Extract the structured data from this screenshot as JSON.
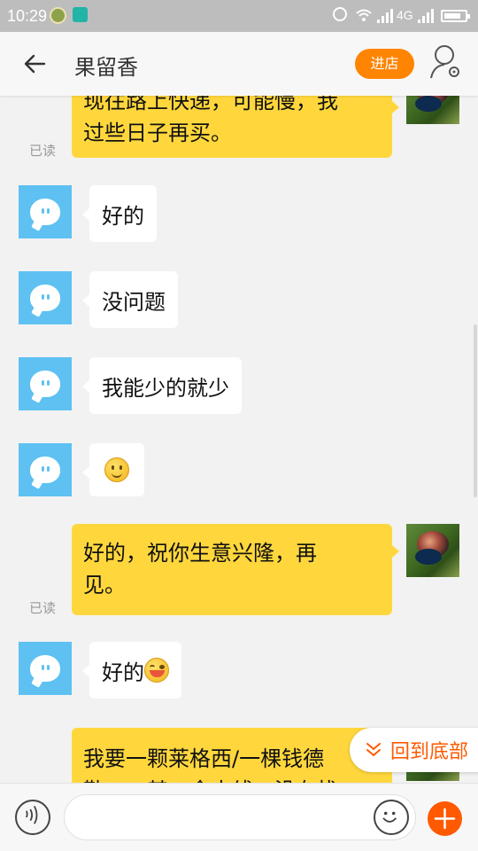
{
  "status_bar": {
    "time": "10:29",
    "network": "4G"
  },
  "header": {
    "title": "果留香",
    "shop_button": "进店"
  },
  "messages": [
    {
      "from": "me",
      "lines": [
        "现往路上快递，可能慢，我",
        "过些日子再买。"
      ],
      "read": "已读"
    },
    {
      "from": "other",
      "text": "好的"
    },
    {
      "from": "other",
      "text": "没问题"
    },
    {
      "from": "other",
      "text": "我能少的就少"
    },
    {
      "from": "other",
      "emoji": "smile-emoji"
    },
    {
      "from": "me",
      "lines": [
        "好的，祝你生意兴隆，再",
        "见。"
      ],
      "read": "已读"
    },
    {
      "from": "other",
      "text": "好的",
      "emoji": "laugh-emoji"
    },
    {
      "from": "me",
      "lines": [
        "我要一颗莱格西/一棵钱德",
        "勒……其一余土线，没有找"
      ]
    }
  ],
  "back_to_bottom": "回到底部",
  "input": {
    "placeholder": ""
  },
  "colors": {
    "accent": "#ff8400",
    "bubble_me": "#ffd73d",
    "bubble_other": "#ffffff",
    "plus": "#ff5a00"
  },
  "icons": [
    "back-arrow-icon",
    "profile-settings-icon",
    "voice-icon",
    "emoji-icon",
    "plus-icon",
    "chevron-down-icon"
  ]
}
